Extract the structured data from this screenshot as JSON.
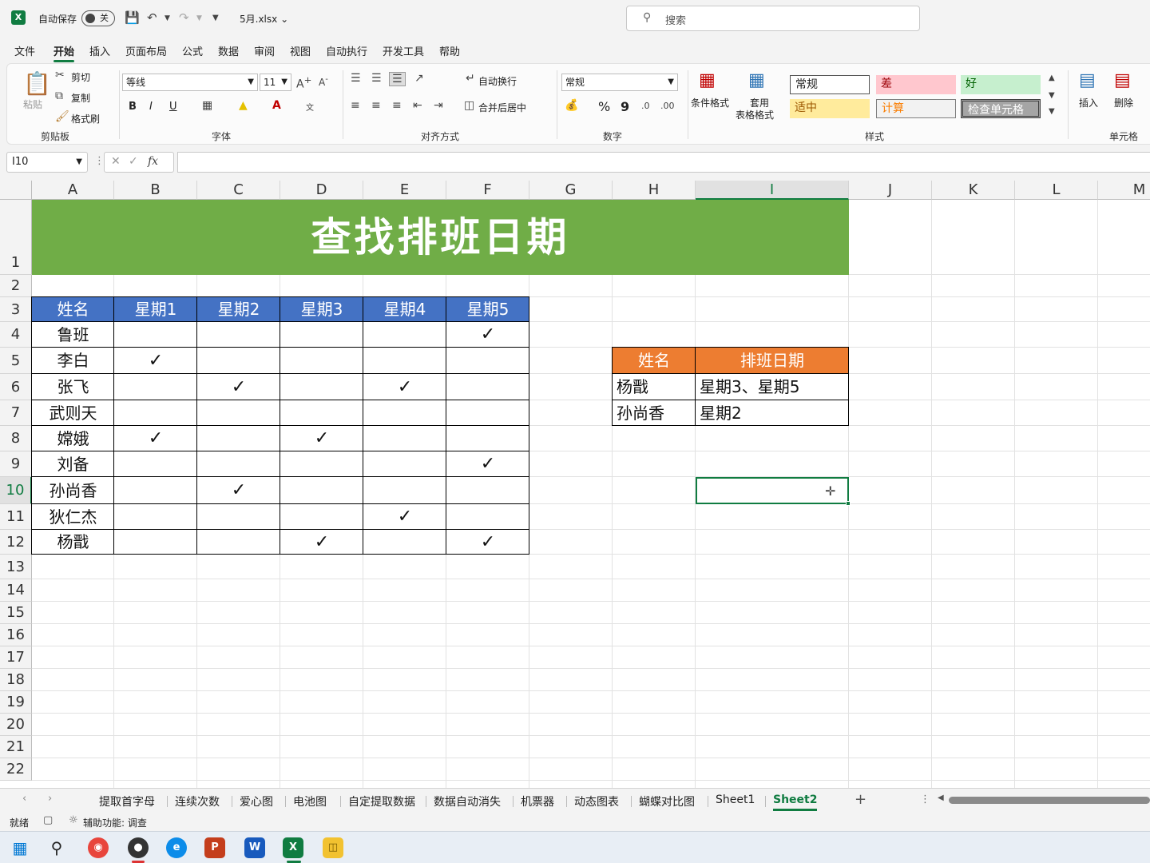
{
  "titlebar": {
    "autosave_label": "自动保存",
    "autosave_state": "关",
    "filename": "5月.xlsx",
    "search_placeholder": "搜索"
  },
  "menu": {
    "tabs": [
      "文件",
      "开始",
      "插入",
      "页面布局",
      "公式",
      "数据",
      "审阅",
      "视图",
      "自动执行",
      "开发工具",
      "帮助"
    ],
    "active": "开始"
  },
  "ribbon": {
    "clipboard": {
      "paste": "粘贴",
      "cut": "剪切",
      "copy": "复制",
      "format_painter": "格式刷",
      "group": "剪贴板"
    },
    "font": {
      "name": "等线",
      "size": "11",
      "bold": "B",
      "italic": "I",
      "underline": "U",
      "group": "字体"
    },
    "alignment": {
      "wrap": "自动换行",
      "merge": "合并后居中",
      "group": "对齐方式"
    },
    "number": {
      "format": "常规",
      "percent": "%",
      "comma": "9",
      "group": "数字"
    },
    "styles": {
      "conditional": "条件格式",
      "table_format_1": "套用",
      "table_format_2": "表格格式",
      "cells": [
        {
          "label": "常规",
          "bg": "#ffffff",
          "fg": "#222222"
        },
        {
          "label": "差",
          "bg": "#ffc7ce",
          "fg": "#9c0006"
        },
        {
          "label": "好",
          "bg": "#c6efce",
          "fg": "#006100"
        },
        {
          "label": "适中",
          "bg": "#ffeb9c",
          "fg": "#9c5700"
        },
        {
          "label": "计算",
          "bg": "#f2f2f2",
          "fg": "#fa7d00"
        },
        {
          "label": "检查单元格",
          "bg": "#a5a5a5",
          "fg": "#ffffff"
        }
      ],
      "group": "样式"
    },
    "cells": {
      "insert": "插入",
      "delete": "删除",
      "group": "单元格"
    }
  },
  "formulabar": {
    "namebox": "I10",
    "fx": "fx",
    "content": ""
  },
  "grid": {
    "columns": [
      "A",
      "B",
      "C",
      "D",
      "E",
      "F",
      "G",
      "H",
      "I",
      "J",
      "K",
      "L",
      "M"
    ],
    "selected_column": "I",
    "rows": [
      "1",
      "2",
      "3",
      "4",
      "5",
      "6",
      "7",
      "8",
      "9",
      "10",
      "11",
      "12",
      "13",
      "14",
      "15",
      "16",
      "17",
      "18",
      "19",
      "20",
      "21",
      "22"
    ],
    "selected_row": "10",
    "banner": "查找排班日期",
    "schedule": {
      "header": [
        "姓名",
        "星期1",
        "星期2",
        "星期3",
        "星期4",
        "星期5"
      ],
      "header_bg": "#4472c4",
      "check": "✓",
      "rows": [
        {
          "name": "鲁班",
          "days": [
            0,
            0,
            0,
            0,
            1
          ]
        },
        {
          "name": "李白",
          "days": [
            1,
            0,
            0,
            0,
            0
          ]
        },
        {
          "name": "张飞",
          "days": [
            0,
            1,
            0,
            1,
            0
          ]
        },
        {
          "name": "武则天",
          "days": [
            0,
            0,
            0,
            0,
            0
          ]
        },
        {
          "name": "嫦娥",
          "days": [
            1,
            0,
            1,
            0,
            0
          ]
        },
        {
          "name": "刘备",
          "days": [
            0,
            0,
            0,
            0,
            1
          ]
        },
        {
          "name": "孙尚香",
          "days": [
            0,
            1,
            0,
            0,
            0
          ]
        },
        {
          "name": "狄仁杰",
          "days": [
            0,
            0,
            0,
            1,
            0
          ]
        },
        {
          "name": "杨戬",
          "days": [
            0,
            0,
            1,
            0,
            1
          ]
        }
      ]
    },
    "lookup": {
      "header": [
        "姓名",
        "排班日期"
      ],
      "header_bg": "#ed7d31",
      "rows": [
        {
          "name": "杨戬",
          "result": "星期3、星期5"
        },
        {
          "name": "孙尚香",
          "result": "星期2"
        }
      ]
    }
  },
  "sheets": {
    "tabs": [
      "提取首字母",
      "连续次数",
      "爱心图",
      "电池图",
      "自定提取数据",
      "数据自动消失",
      "机票器",
      "动态图表",
      "蝴蝶对比图",
      "Sheet1",
      "Sheet2"
    ],
    "active": "Sheet2",
    "add": "+"
  },
  "status": {
    "ready": "就绪",
    "accessibility": "辅助功能: 调查"
  },
  "colors": {
    "excel_green": "#107c41",
    "banner_green": "#70ad47"
  }
}
